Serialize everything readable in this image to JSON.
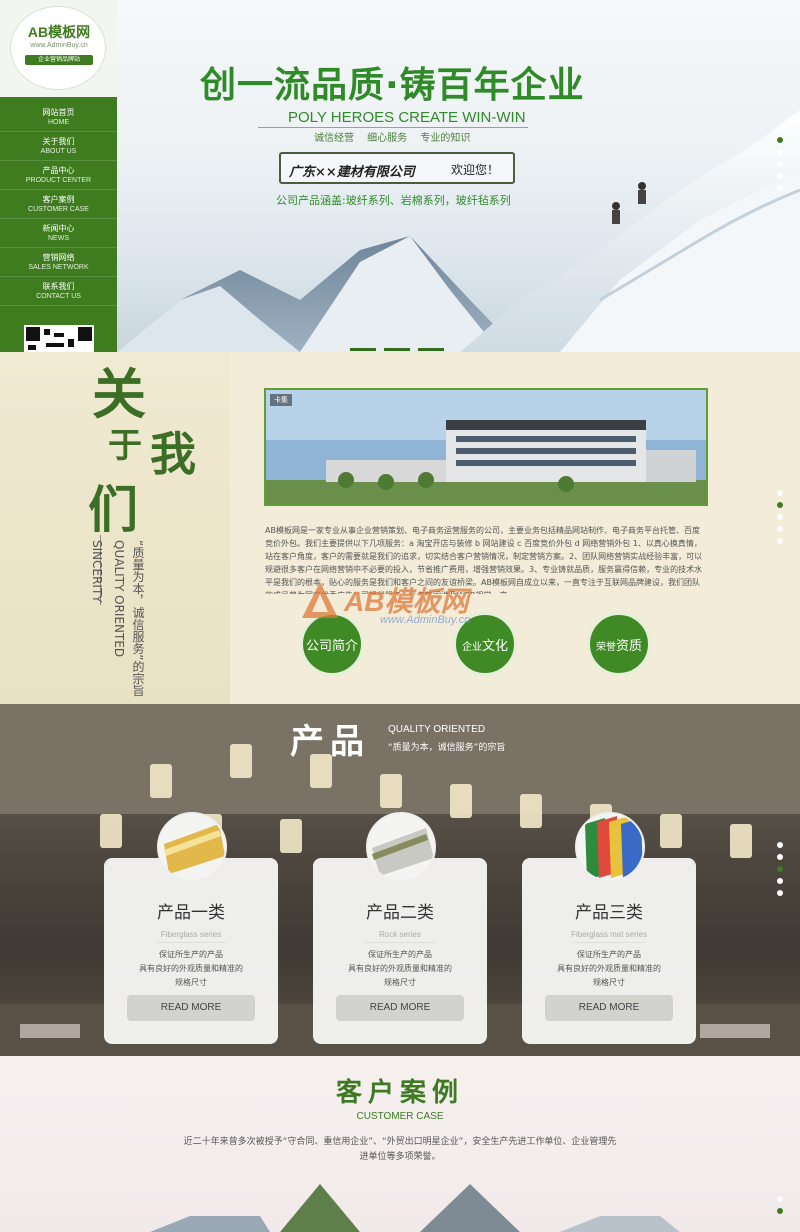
{
  "brand": {
    "logo_text": "AB模板网",
    "logo_url": "www.AdminBuy.cn",
    "logo_tag": "企业营销品牌站"
  },
  "nav": [
    {
      "cn": "网站首页",
      "en": "HOME"
    },
    {
      "cn": "关于我们",
      "en": "ABOUT US"
    },
    {
      "cn": "产品中心",
      "en": "PRODUCT CENTER"
    },
    {
      "cn": "客户案例",
      "en": "CUSTOMER CASE"
    },
    {
      "cn": "新闻中心",
      "en": "NEWS"
    },
    {
      "cn": "营销网络",
      "en": "SALES NETWORK"
    },
    {
      "cn": "联系我们",
      "en": "CONTACT US"
    }
  ],
  "hero": {
    "title": "创一流品质·铸百年企业",
    "subtitle_en": "POLY HEROES CREATE WIN-WIN",
    "slogans": "诚信经营 细心服务 专业的知识",
    "company": "广东××建材有限公司",
    "welcome": "欢迎您！",
    "series": "公司产品涵盖:玻纤系列、岩棉系列，玻纤毡系列"
  },
  "about": {
    "cal_1": "关",
    "cal_2": "于",
    "cal_3": "我",
    "cal_4": "们",
    "vert_en_1": "SINCERITY",
    "vert_en_2": "QUALITY ORIENTED",
    "vert_cn": "“质量为本，诚信服务”的宗旨",
    "photo_tag": "卡集",
    "text": "AB模板网是一家专业从事企业营销策划、电子商务运营服务的公司，主要业务包括精品网站制作、电子商务平台托管、百度竞价外包。我们主要提供以下几项服务：a 淘宝开店与装修 b 网站建设 c 百度竞价外包 d 网络营销外包 1、以真心换真情，站在客户角度，客户的需要就是我们的追求，切实结合客户营销情况，制定营销方案。2、团队网络营销实战经验丰富，可以规避很多客户在网络营销中不必要的投入，节省推广费用，增强营销效果。3、专业铸就品质，服务赢得信赖，专业的技术水平是我们的根本，贴心的服务是我们和客户之间的友谊桥梁。AB模板网自成立以来，一直专注于互联网品牌建设，我们团队的成员曾为国内优秀广告公司提供服务，业务范围涉及WEB视觉、交",
    "btn_intro": "公司简介",
    "btn_culture_a": "企业",
    "btn_culture_b": "文化",
    "btn_honor_a": "荣誉",
    "btn_honor_b": "资质",
    "watermark": "AB模板网",
    "watermark_url": "www.AdminBuy.cn"
  },
  "products": {
    "title": "产品",
    "title_en": "QUALITY ORIENTED",
    "title_sub": "“质量为本，诚信服务”的宗旨",
    "items": [
      {
        "name": "产品一类",
        "en": "Fiberglass series",
        "desc1": "保证所生产的产品",
        "desc2": "具有良好的外观质量和精准的",
        "desc3": "规格尺寸",
        "btn": "READ MORE"
      },
      {
        "name": "产品二类",
        "en": "Rock series",
        "desc1": "保证所生产的产品",
        "desc2": "具有良好的外观质量和精准的",
        "desc3": "规格尺寸",
        "btn": "READ MORE"
      },
      {
        "name": "产品三类",
        "en": "Fiberglass mat series",
        "desc1": "保证所生产的产品",
        "desc2": "具有良好的外观质量和精准的",
        "desc3": "规格尺寸",
        "btn": "READ MORE"
      }
    ]
  },
  "cases": {
    "title": "客户案例",
    "title_en": "CUSTOMER CASE",
    "desc": "近二十年来曾多次被授予“守合同、重信用企业”、“外贸出口明星企业”，安全生产先进工作单位、企业管理先进单位等多项荣誉。"
  },
  "colors": {
    "brand_green": "#3f7c20",
    "accent_green": "#2f8a28"
  }
}
